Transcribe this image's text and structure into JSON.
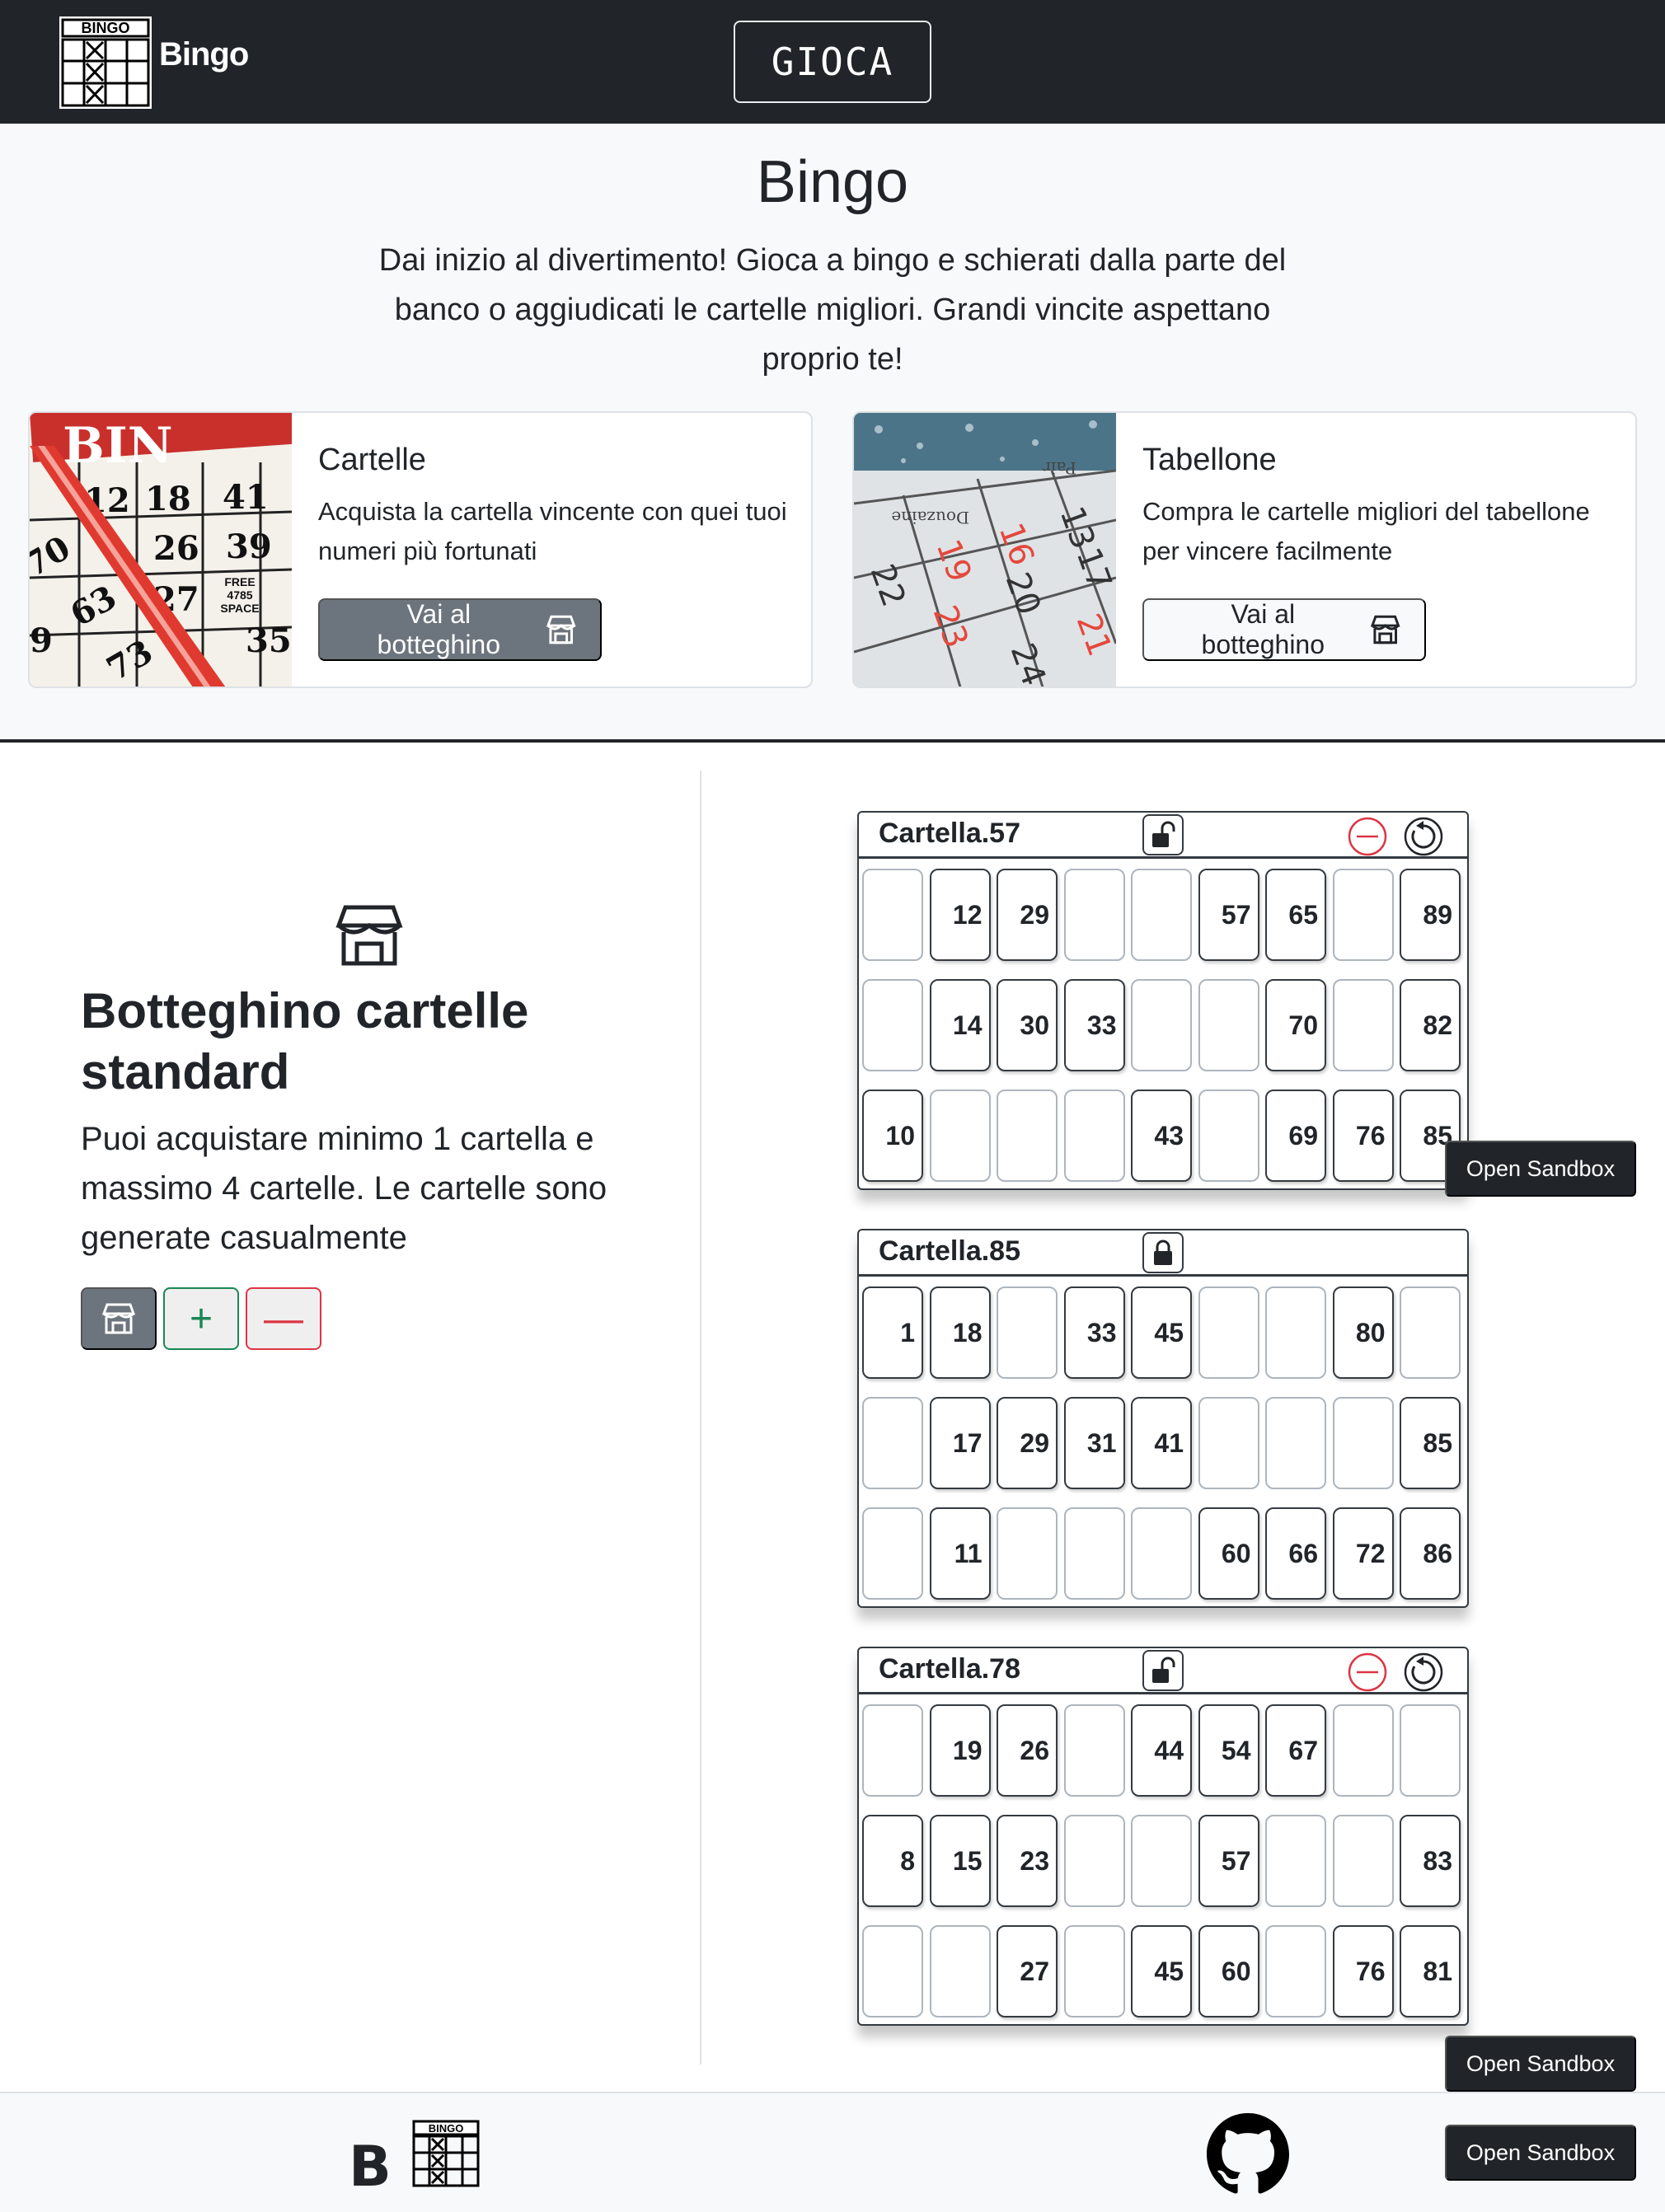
{
  "navbar": {
    "brand": "Bingo",
    "logo_text": "BINGO",
    "play_label": "GIOCA"
  },
  "hero": {
    "title": "Bingo",
    "text": "Dai inizio al divertimento! Gioca a bingo e schierati dalla parte del banco o aggiudicati le cartelle migliori. Grandi vincite aspettano proprio te!"
  },
  "cards": [
    {
      "title": "Cartelle",
      "text": "Acquista la cartella vincente con quei tuoi numeri più fortunati",
      "button": "Vai al botteghino",
      "icon": "shop-icon"
    },
    {
      "title": "Tabellone",
      "text": "Compra le cartelle migliori del tabellone per vincere facilmente",
      "button": "Vai al botteghino",
      "icon": "shop-icon"
    }
  ],
  "card_image_text": {
    "img1": {
      "word": "BIN",
      "nums": [
        "12",
        "18",
        "41",
        "26",
        "39",
        "70",
        "27",
        "63",
        "73",
        "35",
        "9"
      ],
      "free": [
        "FREE",
        "4785",
        "SPACE"
      ]
    },
    "img2": {
      "nums": [
        "13",
        "17",
        "16",
        "19",
        "20",
        "22",
        "23",
        "24",
        "21"
      ],
      "words": [
        "Douzaine",
        "Pair"
      ]
    }
  },
  "shop": {
    "title": "Botteghino cartelle standard",
    "text": "Puoi acquistare minimo 1 cartella e massimo 4 cartelle. Le cartelle sono generate casualmente",
    "controls": {
      "plus": "+",
      "minus": "—"
    }
  },
  "bingo_cards": [
    {
      "name": "Cartella.57",
      "locked": false,
      "rows": [
        [
          "",
          "12",
          "29",
          "",
          "",
          "57",
          "65",
          "",
          "89"
        ],
        [
          "",
          "14",
          "30",
          "33",
          "",
          "",
          "70",
          "",
          "82"
        ],
        [
          "10",
          "",
          "",
          "",
          "43",
          "",
          "69",
          "76",
          "85"
        ]
      ]
    },
    {
      "name": "Cartella.85",
      "locked": true,
      "rows": [
        [
          "1",
          "18",
          "",
          "33",
          "45",
          "",
          "",
          "80",
          ""
        ],
        [
          "",
          "17",
          "29",
          "31",
          "41",
          "",
          "",
          "",
          "85"
        ],
        [
          "",
          "11",
          "",
          "",
          "",
          "60",
          "66",
          "72",
          "86"
        ]
      ]
    },
    {
      "name": "Cartella.78",
      "locked": false,
      "rows": [
        [
          "",
          "19",
          "26",
          "",
          "44",
          "54",
          "67",
          "",
          ""
        ],
        [
          "8",
          "15",
          "23",
          "",
          "",
          "57",
          "",
          "",
          "83"
        ],
        [
          "",
          "",
          "27",
          "",
          "45",
          "60",
          "",
          "76",
          "81"
        ]
      ]
    }
  ],
  "sandbox_buttons": [
    "Open Sandbox",
    "Open Sandbox",
    "Open Sandbox"
  ],
  "footer": {
    "brand_letter": "B",
    "logo_text": "BINGO",
    "icon": "github-icon"
  }
}
